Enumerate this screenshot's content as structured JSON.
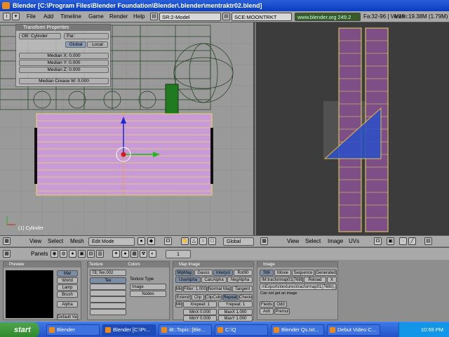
{
  "window": {
    "title": "Blender [C:\\Program Files\\Blender Foundation\\Blender\\.blender\\mentraktr02.blend]"
  },
  "main_header": {
    "menus": [
      "File",
      "Add",
      "Timeline",
      "Game",
      "Render",
      "Help"
    ],
    "screen": "SR:2-Model",
    "scene": "SCE:MOONTRKT",
    "url": "www.blender.org 249.2",
    "stats": "Fa:32-96  |  Ve:19",
    "mem": "Mem:19.38M (1.79M)"
  },
  "transform_panel": {
    "title": "Transform Properties",
    "ob_label": "OB: Cylinder",
    "par_label": "Par:",
    "global": "Global",
    "local": "Local",
    "median_x": "Median X: 0.000",
    "median_y": "Median Y: 0.000",
    "median_z": "Median Z: 0.000",
    "median_crease": "Median Crease W: 0.000"
  },
  "view3d": {
    "object_label": "(1) Cylinder",
    "menus": [
      "View",
      "Select",
      "Mesh"
    ],
    "mode": "Edit Mode",
    "orientation": "Global"
  },
  "uv_editor": {
    "menus": [
      "View",
      "Select",
      "Image",
      "UVs"
    ]
  },
  "buttons_header": {
    "panels": "Panels",
    "frame": "1"
  },
  "preview": {
    "title": "Preview",
    "buttons": [
      "Mat",
      "World",
      "Lamp",
      "Brush",
      "Alpha",
      "Default Vars"
    ]
  },
  "texture_panel": {
    "tab_texture": "Texture",
    "tab_colors": "Colors",
    "texname": "TE:Tex.002",
    "tex": "Tex",
    "texture_type": "Texture Type",
    "image": "Image",
    "nodes": "Nodes"
  },
  "map_image": {
    "title": "Map Image",
    "row1": [
      "MipMap",
      "Gauss",
      "Interpol",
      "Rot90"
    ],
    "row2": [
      "UseAlpha",
      "CalcAlpha",
      "NegAlpha"
    ],
    "min": "Min",
    "filter": "Filter: 1.000",
    "normal_map": "Normal Map",
    "tangent": "Tangent",
    "row4": [
      "Extend",
      "Clip",
      "ClipCube",
      "Repeat",
      "Checker"
    ],
    "xrepeat": "Xrepeat: 1",
    "yrepeat": "Yrepeat: 1",
    "minx": "MinX 0.000",
    "maxx": "MaxX 1.000",
    "miny": "MinY 0.000",
    "maxy": "MaxY 1.000"
  },
  "image_panel": {
    "title": "Image",
    "row1": [
      "Still",
      "Movie",
      "Sequence",
      "Generated"
    ],
    "im_name": "IM:tracformap01(768b).jp",
    "reload": "Reload",
    "x_label": "X",
    "path": "n\\Exports\\textures\\tracformap01(768b).jpg",
    "info": "Can not get an image",
    "fields": "Fields",
    "odd": "Odd",
    "anti": "Anti",
    "premul": "Premul"
  },
  "taskbar": {
    "start": "start",
    "tasks": [
      "Blender",
      "Blender [C:\\Pr...",
      "iB::Topic::[Ble...",
      "C:\\Q",
      "Blender Qs.txt...",
      "Debut Video C..."
    ],
    "clock": "10:59 PM"
  },
  "colors": {
    "mesh_face": "#c89ad8",
    "uv_strip": "#7e4f86",
    "selected_edge": "#e8d85a",
    "title_blue": "#0a3cc0"
  }
}
